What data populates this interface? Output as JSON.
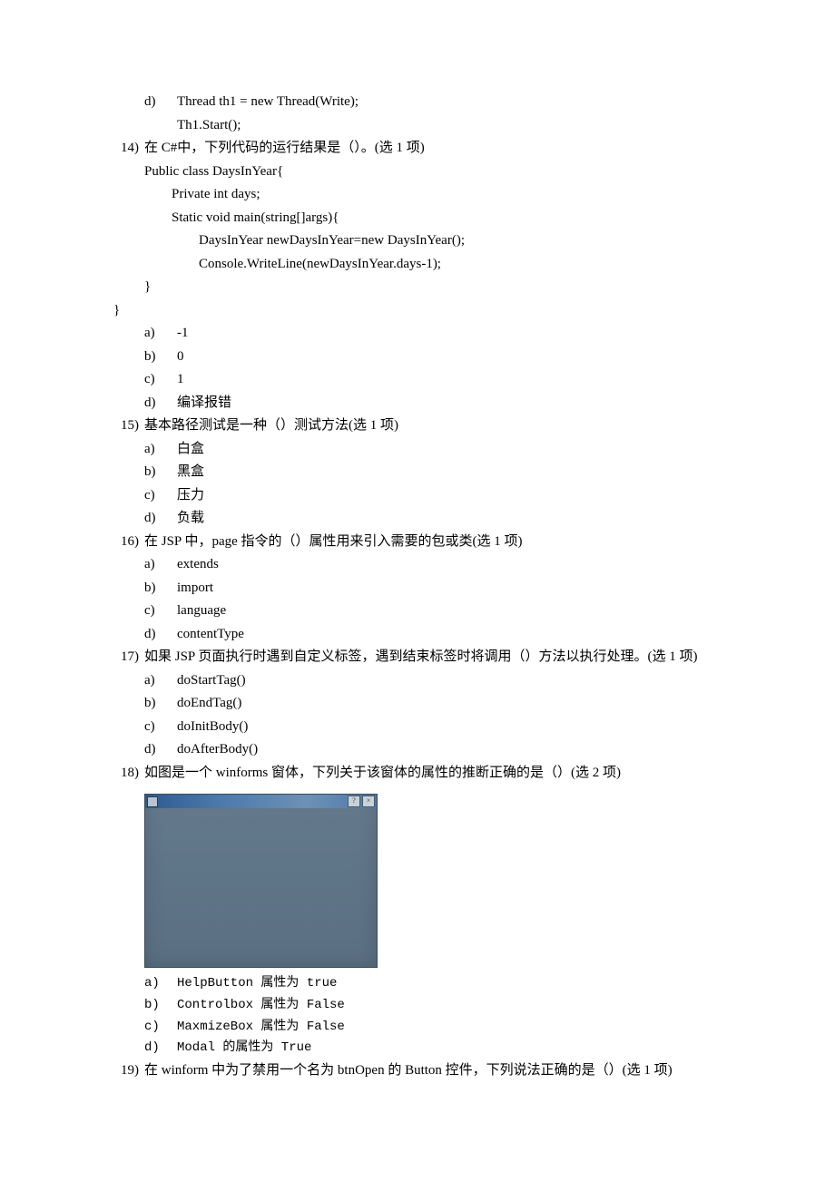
{
  "q13": {
    "opts": {
      "d": {
        "letter": "d)",
        "l1": "Thread th1 = new Thread(Write);",
        "l2": "Th1.Start();"
      }
    }
  },
  "q14": {
    "num": "14)",
    "text": "在 C#中，下列代码的运行结果是（）。(选 1 项)",
    "code": {
      "l1": "Public class DaysInYear{",
      "l2": "Private int days;",
      "l3": "Static void main(string[]args){",
      "l4": "DaysInYear newDaysInYear=new DaysInYear();",
      "l5": "Console.WriteLine(newDaysInYear.days-1);",
      "l6": "}",
      "l7": "}"
    },
    "opts": {
      "a": {
        "letter": "a)",
        "text": "-1"
      },
      "b": {
        "letter": "b)",
        "text": "0"
      },
      "c": {
        "letter": "c)",
        "text": "1"
      },
      "d": {
        "letter": "d)",
        "text": "编译报错"
      }
    }
  },
  "q15": {
    "num": "15)",
    "text": "基本路径测试是一种（）测试方法(选 1 项)",
    "opts": {
      "a": {
        "letter": "a)",
        "text": "白盒"
      },
      "b": {
        "letter": "b)",
        "text": "黑盒"
      },
      "c": {
        "letter": "c)",
        "text": "压力"
      },
      "d": {
        "letter": "d)",
        "text": "负载"
      }
    }
  },
  "q16": {
    "num": "16)",
    "text": "在 JSP 中，page 指令的（）属性用来引入需要的包或类(选 1 项)",
    "opts": {
      "a": {
        "letter": "a)",
        "text": "extends"
      },
      "b": {
        "letter": "b)",
        "text": "import"
      },
      "c": {
        "letter": "c)",
        "text": "language"
      },
      "d": {
        "letter": "d)",
        "text": "contentType"
      }
    }
  },
  "q17": {
    "num": "17)",
    "text": "如果 JSP 页面执行时遇到自定义标签，遇到结束标签时将调用（）方法以执行处理。(选 1 项)",
    "opts": {
      "a": {
        "letter": "a)",
        "text": "doStartTag()"
      },
      "b": {
        "letter": "b)",
        "text": "doEndTag()"
      },
      "c": {
        "letter": "c)",
        "text": "doInitBody()"
      },
      "d": {
        "letter": "d)",
        "text": "doAfterBody()"
      }
    }
  },
  "q18": {
    "num": "18)",
    "text": "如图是一个 winforms 窗体，下列关于该窗体的属性的推断正确的是（）(选 2 项)",
    "window": {
      "help": "?",
      "close": "×"
    },
    "opts": {
      "a": {
        "letter": "a)",
        "text": "HelpButton 属性为 true"
      },
      "b": {
        "letter": "b)",
        "text": "Controlbox 属性为 False"
      },
      "c": {
        "letter": "c)",
        "text": "MaxmizeBox 属性为 False"
      },
      "d": {
        "letter": "d)",
        "text": "Modal 的属性为 True"
      }
    }
  },
  "q19": {
    "num": "19)",
    "text": "在 winform 中为了禁用一个名为 btnOpen 的 Button 控件，下列说法正确的是（）(选 1 项)"
  }
}
